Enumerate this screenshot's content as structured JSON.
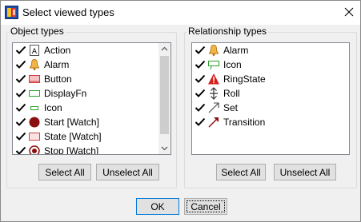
{
  "window": {
    "title": "Select viewed types"
  },
  "object_group": {
    "label": "Object types",
    "items": [
      {
        "label": "Action",
        "checked": true,
        "icon": "action-icon"
      },
      {
        "label": "Alarm",
        "checked": true,
        "icon": "bell-icon"
      },
      {
        "label": "Button",
        "checked": true,
        "icon": "button-icon"
      },
      {
        "label": "DisplayFn",
        "checked": true,
        "icon": "displayfn-icon"
      },
      {
        "label": "Icon",
        "checked": true,
        "icon": "icon-shape-icon"
      },
      {
        "label": "Start [Watch]",
        "checked": true,
        "icon": "start-state-icon"
      },
      {
        "label": "State [Watch]",
        "checked": true,
        "icon": "state-icon"
      },
      {
        "label": "Stop [Watch]",
        "checked": true,
        "icon": "stop-state-icon"
      }
    ],
    "select_all": "Select All",
    "unselect_all": "Unselect All"
  },
  "relationship_group": {
    "label": "Relationship types",
    "items": [
      {
        "label": "Alarm",
        "checked": true,
        "icon": "bell-icon"
      },
      {
        "label": "Icon",
        "checked": true,
        "icon": "icon-shape-icon"
      },
      {
        "label": "RingState",
        "checked": true,
        "icon": "warning-icon"
      },
      {
        "label": "Roll",
        "checked": true,
        "icon": "roll-arrows-icon"
      },
      {
        "label": "Set",
        "checked": true,
        "icon": "set-arrow-icon"
      },
      {
        "label": "Transition",
        "checked": true,
        "icon": "transition-arrow-icon"
      }
    ],
    "select_all": "Select All",
    "unselect_all": "Unselect All"
  },
  "footer": {
    "ok": "OK",
    "cancel": "Cancel"
  },
  "colors": {
    "accent": "#0078d7",
    "dialog_bg": "#f0f0f0",
    "list_border": "#828790"
  }
}
